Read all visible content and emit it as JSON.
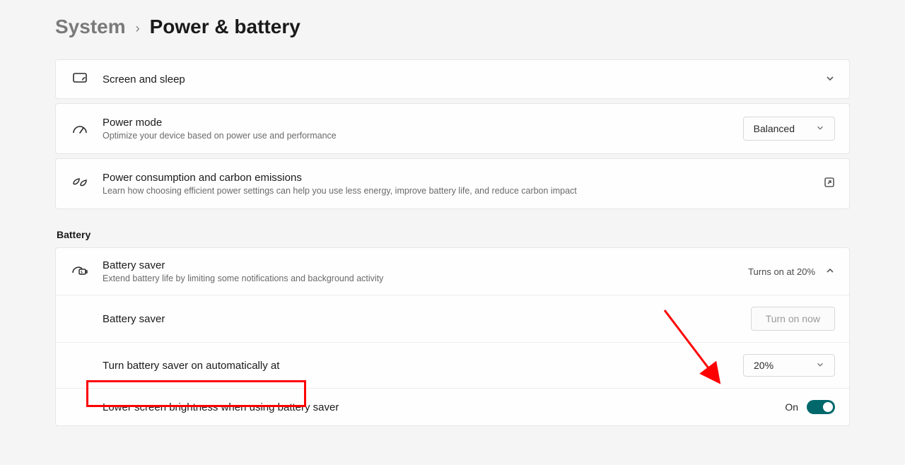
{
  "breadcrumb": {
    "parent": "System",
    "current": "Power & battery"
  },
  "cards": {
    "screen_sleep": {
      "title": "Screen and sleep"
    },
    "power_mode": {
      "title": "Power mode",
      "sub": "Optimize your device based on power use and performance",
      "value": "Balanced"
    },
    "carbon": {
      "title": "Power consumption and carbon emissions",
      "sub": "Learn how choosing efficient power settings can help you use less energy, improve battery life, and reduce carbon impact"
    }
  },
  "section_battery_header": "Battery",
  "battery_saver": {
    "title": "Battery saver",
    "sub": "Extend battery life by limiting some notifications and background activity",
    "status": "Turns on at 20%",
    "rows": {
      "toggle_now": {
        "label": "Battery saver",
        "button": "Turn on now"
      },
      "auto_at": {
        "label": "Turn battery saver on automatically at",
        "value": "20%"
      },
      "brightness": {
        "label": "Lower screen brightness when using battery saver",
        "toggle_label": "On"
      }
    }
  }
}
